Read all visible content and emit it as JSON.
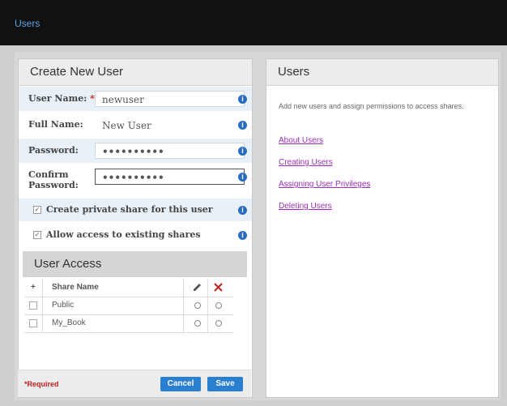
{
  "topbar": {
    "title": "Users"
  },
  "left_panel": {
    "title": "Create New User",
    "fields": {
      "user_name": {
        "label": "User Name:",
        "required_mark": "*",
        "value": "newuser"
      },
      "full_name": {
        "label": "Full Name:",
        "value": "New User"
      },
      "password": {
        "label": "Password:",
        "value": "••••••••••"
      },
      "confirm_password": {
        "label": "Confirm Password:",
        "value": "••••••••••"
      }
    },
    "options": [
      {
        "label": "Create private share for this user",
        "checked": true
      },
      {
        "label": "Allow access to existing shares",
        "checked": true
      }
    ],
    "user_access": {
      "title": "User Access",
      "columns": {
        "add": "+",
        "share_name": "Share Name"
      },
      "rows": [
        {
          "name": "Public"
        },
        {
          "name": "My_Book"
        }
      ]
    },
    "footer": {
      "required_note": "*Required",
      "cancel": "Cancel",
      "save": "Save"
    }
  },
  "right_panel": {
    "title": "Users",
    "description": "Add new users and assign permissions to access shares.",
    "links": [
      "About Users",
      "Creating Users",
      "Assigning User Privileges",
      "Deleting Users"
    ]
  },
  "icons": {
    "info": "info-icon",
    "edit": "pencil-icon",
    "deny": "x-icon"
  },
  "colors": {
    "accent": "#2a7fd0",
    "link": "#9b2fb6",
    "required": "#c02020"
  }
}
